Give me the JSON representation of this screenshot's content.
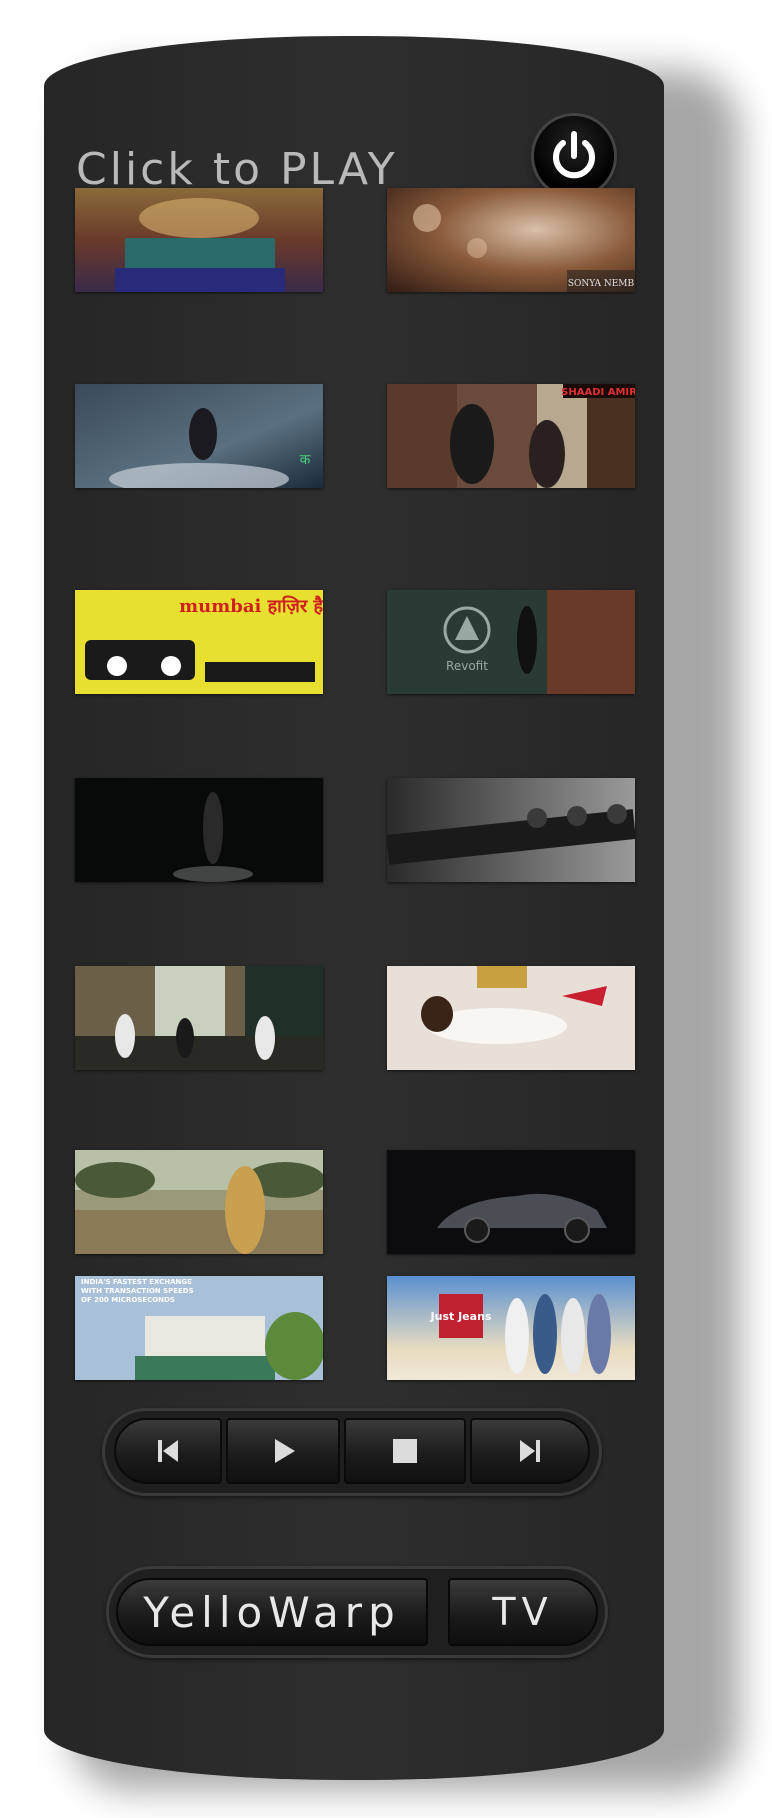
{
  "header": {
    "title": "Click to PLAY"
  },
  "power_button": {
    "icon": "power-icon"
  },
  "videos": [
    {
      "name": "video-1",
      "overlay": ""
    },
    {
      "name": "video-2",
      "overlay": "SONYA NEMB"
    },
    {
      "name": "video-3",
      "overlay": ""
    },
    {
      "name": "video-4",
      "overlay": "SHAADI AMIR"
    },
    {
      "name": "video-5",
      "overlay": "mumbai हाज़िर है!"
    },
    {
      "name": "video-6",
      "overlay": "Revofit"
    },
    {
      "name": "video-7",
      "overlay": ""
    },
    {
      "name": "video-8",
      "overlay": ""
    },
    {
      "name": "video-9",
      "overlay": ""
    },
    {
      "name": "video-10",
      "overlay": ""
    },
    {
      "name": "video-11",
      "overlay": ""
    },
    {
      "name": "video-12",
      "overlay": ""
    },
    {
      "name": "video-13",
      "overlay": "INDIA'S FASTEST EXCHANGE WITH TRANSACTION SPEEDS OF 200 MICROSECONDS"
    },
    {
      "name": "video-14",
      "overlay": "Just Jeans"
    }
  ],
  "transport": {
    "prev_icon": "skip-previous-icon",
    "play_icon": "play-icon",
    "stop_icon": "stop-icon",
    "next_icon": "skip-next-icon"
  },
  "brand": {
    "name": "YelloWarp",
    "tv": "TV"
  },
  "colors": {
    "body": "#2b2b2b",
    "text": "#b9b9b9",
    "button_text": "#e8e8e8"
  }
}
